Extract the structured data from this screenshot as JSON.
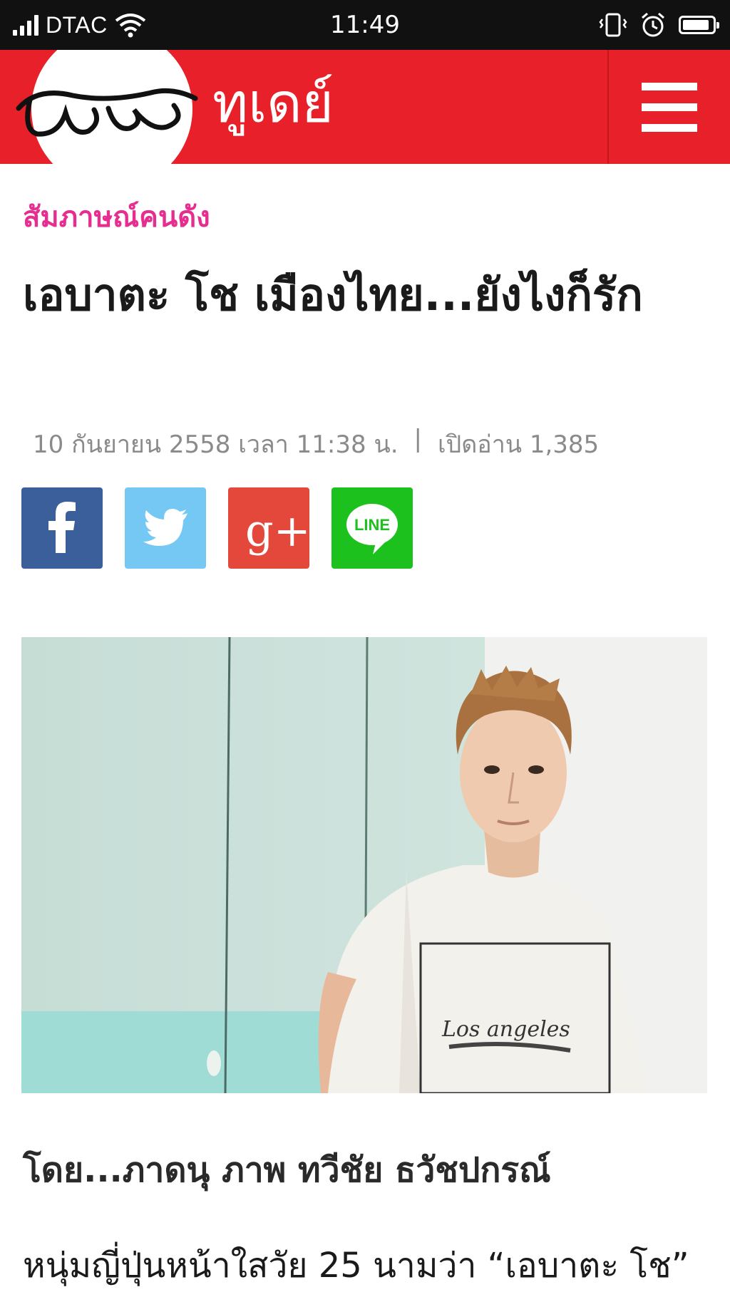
{
  "status_bar": {
    "carrier": "DTAC",
    "time": "11:49",
    "battery_level": 0.9
  },
  "header": {
    "logo_script_text": "โพสต์",
    "logo_text": "ทูเดย์",
    "menu_icon": "hamburger-menu-icon",
    "brand_color": "#e8202a"
  },
  "article": {
    "category": "สัมภาษณ์คนดัง",
    "category_color": "#e52e8f",
    "headline": "เอบาตะ โช เมืองไทย...ยังไงก็รัก",
    "date": "10 กันยายน 2558 เวลา 11:38 น.",
    "separator": "|",
    "views": "เปิดอ่าน 1,385",
    "byline": "โดย...ภาดนุ ภาพ ทวีชัย ธวัชปกรณ์",
    "lead": "หนุ่มญี่ปุ่นหน้าใสวัย 25 นามว่า “เอบาตะ โช”"
  },
  "share_buttons": [
    {
      "icon": "facebook-icon",
      "color": "#3b5f9b"
    },
    {
      "icon": "twitter-icon",
      "color": "#74c8f3"
    },
    {
      "icon": "google-plus-icon",
      "color": "#e3483a",
      "label": "g+"
    },
    {
      "icon": "line-icon",
      "color": "#1dc11e",
      "label": "LINE"
    }
  ],
  "photo": {
    "shirt_text": "Los angeles"
  }
}
